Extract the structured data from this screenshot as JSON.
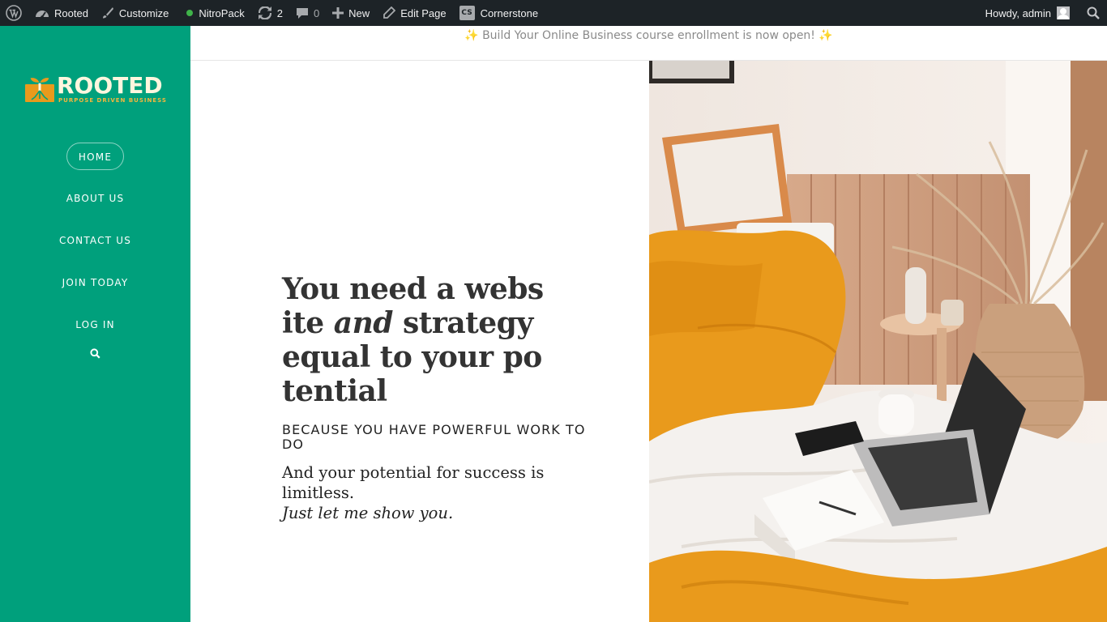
{
  "adminbar": {
    "site_name": "Rooted",
    "customize": "Customize",
    "nitropack": "NitroPack",
    "updates_count": "2",
    "comments_count": "0",
    "new": "New",
    "edit_page": "Edit Page",
    "cornerstone_badge": "CS",
    "cornerstone": "Cornerstone",
    "howdy": "Howdy, admin"
  },
  "sidebar": {
    "logo_text": "ROOTED",
    "logo_sub": "PURPOSE DRIVEN BUSINESS",
    "nav": [
      "HOME",
      "ABOUT US",
      "CONTACT US",
      "JOIN TODAY",
      "LOG IN"
    ],
    "active": "HOME"
  },
  "announcement": {
    "sparkle": "✨",
    "text": "Build Your Online Business course enrollment is now open!"
  },
  "hero": {
    "headline_a": "You need a website ",
    "headline_em": "and",
    "headline_b": " strategy equal to your potential",
    "subhead": "BECAUSE YOU HAVE POWERFUL WORK TO DO",
    "lead": "And your potential for success is limitless.",
    "lead_italic": "Just let me show you."
  },
  "colors": {
    "sidebar": "#00a07c",
    "adminbar": "#1d2327",
    "accent_orange": "#e99a1c"
  }
}
